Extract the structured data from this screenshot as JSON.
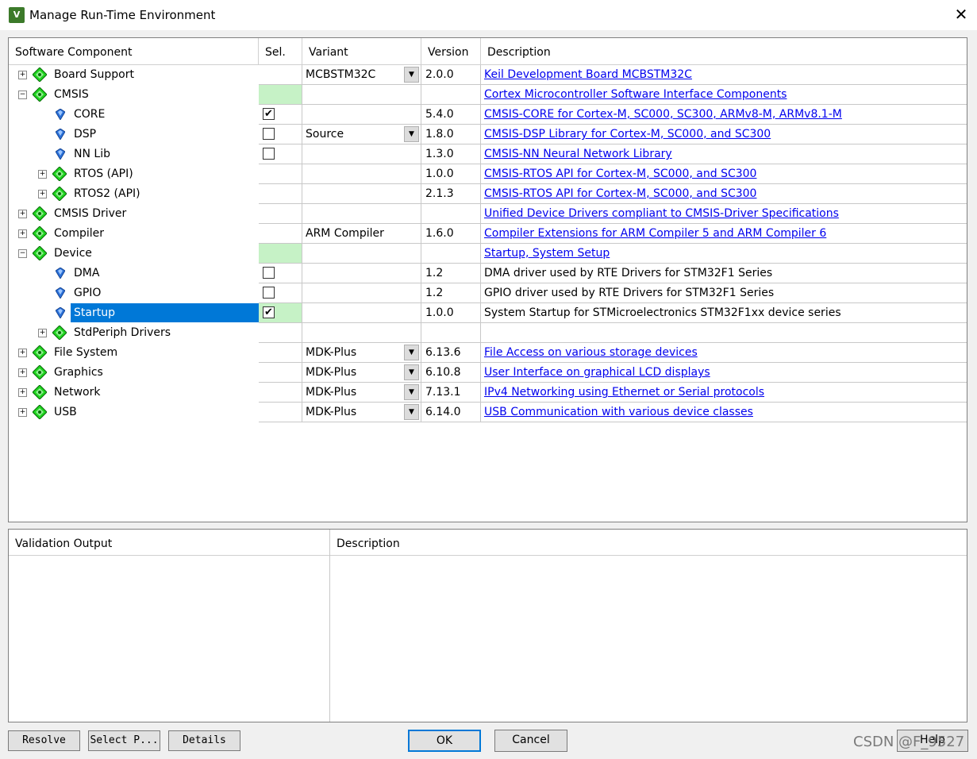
{
  "window": {
    "title": "Manage Run-Time Environment",
    "icon_label": "V",
    "close_glyph": "✕"
  },
  "columns": {
    "component": "Software Component",
    "sel": "Sel.",
    "variant": "Variant",
    "version": "Version",
    "description": "Description"
  },
  "rows": [
    {
      "label": "Board Support",
      "level": 0,
      "expander": "+",
      "icon": "green-diamond-icon",
      "sel": "",
      "variant": "MCBSTM32C",
      "variant_dropdown": true,
      "version": "2.0.0",
      "description": "Keil Development Board MCBSTM32C",
      "link": true
    },
    {
      "label": "CMSIS",
      "level": 0,
      "expander": "-",
      "icon": "green-diamond-icon",
      "sel": "green",
      "variant": "",
      "variant_dropdown": false,
      "version": "",
      "description": "Cortex Microcontroller Software Interface Components",
      "link": true
    },
    {
      "label": "CORE",
      "level": 1,
      "expander": "",
      "icon": "blue-pin-icon",
      "sel": "checked",
      "variant": "",
      "variant_dropdown": false,
      "version": "5.4.0",
      "description": "CMSIS-CORE for Cortex-M, SC000, SC300, ARMv8-M, ARMv8.1-M",
      "link": true
    },
    {
      "label": "DSP",
      "level": 1,
      "expander": "",
      "icon": "blue-pin-icon",
      "sel": "unchecked",
      "variant": "Source",
      "variant_dropdown": true,
      "version": "1.8.0",
      "description": "CMSIS-DSP Library for Cortex-M, SC000, and SC300",
      "link": true
    },
    {
      "label": "NN Lib",
      "level": 1,
      "expander": "",
      "icon": "blue-pin-icon",
      "sel": "unchecked",
      "variant": "",
      "variant_dropdown": false,
      "version": "1.3.0",
      "description": "CMSIS-NN Neural Network Library",
      "link": true
    },
    {
      "label": "RTOS (API)",
      "level": 1,
      "expander": "+",
      "icon": "green-diamond-icon",
      "sel": "",
      "variant": "",
      "variant_dropdown": false,
      "version": "1.0.0",
      "description": "CMSIS-RTOS API for Cortex-M, SC000, and SC300",
      "link": true
    },
    {
      "label": "RTOS2 (API)",
      "level": 1,
      "expander": "+",
      "icon": "green-diamond-icon",
      "sel": "",
      "variant": "",
      "variant_dropdown": false,
      "version": "2.1.3",
      "description": "CMSIS-RTOS API for Cortex-M, SC000, and SC300",
      "link": true
    },
    {
      "label": "CMSIS Driver",
      "level": 0,
      "expander": "+",
      "icon": "green-diamond-icon",
      "sel": "",
      "variant": "",
      "variant_dropdown": false,
      "version": "",
      "description": "Unified Device Drivers compliant to CMSIS-Driver Specifications",
      "link": true
    },
    {
      "label": "Compiler",
      "level": 0,
      "expander": "+",
      "icon": "green-diamond-icon",
      "sel": "",
      "variant": "ARM Compiler",
      "variant_dropdown": false,
      "version": "1.6.0",
      "description": "Compiler Extensions for ARM Compiler 5 and ARM Compiler 6",
      "link": true
    },
    {
      "label": "Device",
      "level": 0,
      "expander": "-",
      "icon": "green-diamond-icon",
      "sel": "green",
      "variant": "",
      "variant_dropdown": false,
      "version": "",
      "description": "Startup, System Setup",
      "link": true
    },
    {
      "label": "DMA",
      "level": 1,
      "expander": "",
      "icon": "blue-pin-icon",
      "sel": "unchecked",
      "variant": "",
      "variant_dropdown": false,
      "version": "1.2",
      "description": "DMA driver used by RTE Drivers for STM32F1 Series",
      "link": false
    },
    {
      "label": "GPIO",
      "level": 1,
      "expander": "",
      "icon": "blue-pin-icon",
      "sel": "unchecked",
      "variant": "",
      "variant_dropdown": false,
      "version": "1.2",
      "description": "GPIO driver used by RTE Drivers for STM32F1 Series",
      "link": false
    },
    {
      "label": "Startup",
      "level": 1,
      "expander": "",
      "icon": "blue-pin-icon",
      "sel": "checked-green",
      "selected": true,
      "variant": "",
      "variant_dropdown": false,
      "version": "1.0.0",
      "description": "System Startup for STMicroelectronics STM32F1xx device series",
      "link": false
    },
    {
      "label": "StdPeriph Drivers",
      "level": 1,
      "expander": "+",
      "icon": "green-diamond-icon",
      "sel": "",
      "variant": "",
      "variant_dropdown": false,
      "version": "",
      "description": "",
      "link": false
    },
    {
      "label": "File System",
      "level": 0,
      "expander": "+",
      "icon": "green-diamond-icon",
      "sel": "",
      "variant": "MDK-Plus",
      "variant_dropdown": true,
      "version": "6.13.6",
      "description": "File Access on various storage devices",
      "link": true
    },
    {
      "label": "Graphics",
      "level": 0,
      "expander": "+",
      "icon": "green-diamond-icon",
      "sel": "",
      "variant": "MDK-Plus",
      "variant_dropdown": true,
      "version": "6.10.8",
      "description": "User Interface on graphical LCD displays",
      "link": true
    },
    {
      "label": "Network",
      "level": 0,
      "expander": "+",
      "icon": "green-diamond-icon",
      "sel": "",
      "variant": "MDK-Plus",
      "variant_dropdown": true,
      "version": "7.13.1",
      "description": "IPv4 Networking using Ethernet or Serial protocols",
      "link": true
    },
    {
      "label": "USB",
      "level": 0,
      "expander": "+",
      "icon": "green-diamond-icon",
      "sel": "",
      "variant": "MDK-Plus",
      "variant_dropdown": true,
      "version": "6.14.0",
      "description": "USB Communication with various device classes",
      "link": true
    }
  ],
  "validation": {
    "col_output": "Validation Output",
    "col_description": "Description"
  },
  "buttons": {
    "resolve": "Resolve",
    "select_packs": "Select P...",
    "details": "Details",
    "ok": "OK",
    "cancel": "Cancel",
    "help": "Help"
  },
  "watermark": "CSDN @F_9527",
  "colors": {
    "selection": "#0078d7",
    "sel_green": "#c6f2c6",
    "link": "#0000ee",
    "diamond": "#1fd41f"
  }
}
